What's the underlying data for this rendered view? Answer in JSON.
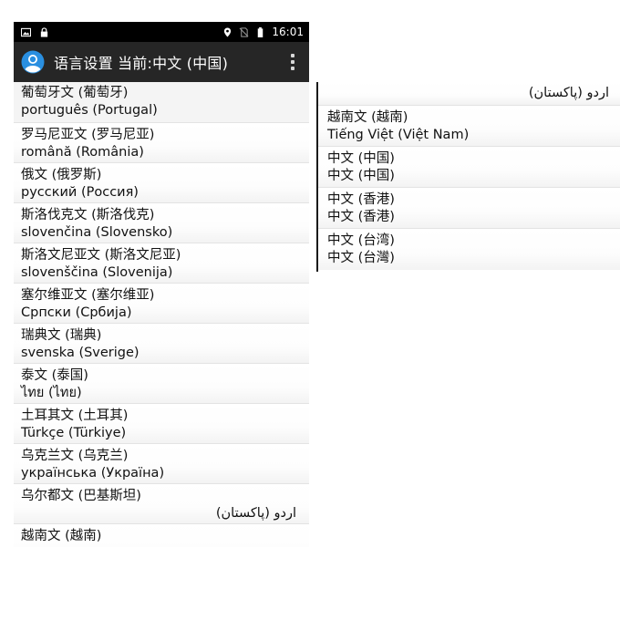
{
  "status_bar": {
    "time": "16:01",
    "left_icons": [
      "image-icon",
      "lock-icon"
    ],
    "right_icons": [
      "location-icon",
      "no-sim-icon",
      "battery-icon"
    ]
  },
  "app_bar": {
    "title": "语言设置 当前:中文 (中国)",
    "icon": "app-avatar-icon",
    "menu_icon": "overflow-menu-icon"
  },
  "languages": [
    {
      "name": "葡萄牙文 (葡萄牙)",
      "native": "português (Portugal)"
    },
    {
      "name": "罗马尼亚文 (罗马尼亚)",
      "native": "română (România)"
    },
    {
      "name": "俄文 (俄罗斯)",
      "native": "русский (Россия)"
    },
    {
      "name": "斯洛伐克文 (斯洛伐克)",
      "native": "slovenčina (Slovensko)"
    },
    {
      "name": "斯洛文尼亚文 (斯洛文尼亚)",
      "native": "slovenščina (Slovenija)"
    },
    {
      "name": "塞尔维亚文 (塞尔维亚)",
      "native": "Српски (Србија)"
    },
    {
      "name": "瑞典文 (瑞典)",
      "native": "svenska (Sverige)"
    },
    {
      "name": "泰文 (泰国)",
      "native": "ไทย (ไทย)"
    },
    {
      "name": "土耳其文 (土耳其)",
      "native": "Türkçe (Türkiye)"
    },
    {
      "name": "乌克兰文 (乌克兰)",
      "native": "українська (Україна)"
    },
    {
      "name": "乌尔都文 (巴基斯坦)",
      "native": "اردو (پاکستان)"
    },
    {
      "name": "越南文 (越南)",
      "native": ""
    }
  ],
  "languages_continued": [
    {
      "name": "",
      "native": "اردو (پاکستان)"
    },
    {
      "name": "越南文 (越南)",
      "native": "Tiếng Việt (Việt Nam)"
    },
    {
      "name": "中文 (中国)",
      "native": "中文 (中国)"
    },
    {
      "name": "中文 (香港)",
      "native": "中文 (香港)"
    },
    {
      "name": "中文 (台湾)",
      "native": "中文 (台灣)"
    }
  ],
  "colors": {
    "status_bar": "#000000",
    "app_bar": "#262626",
    "app_icon_blue": "#2a8fe0",
    "divider": "#e3e3e3"
  }
}
